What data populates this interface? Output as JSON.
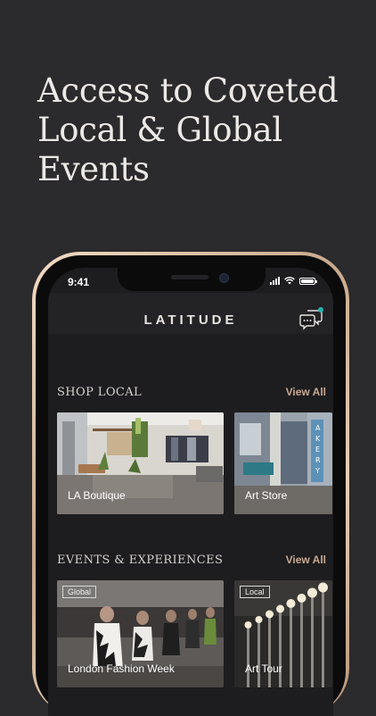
{
  "headline": "Access to Coveted Local & Global Events",
  "status": {
    "time": "9:41"
  },
  "app": {
    "logo": "LATITUDE"
  },
  "icons": {
    "chat": "chat-bubbles-icon",
    "signal": "signal-icon",
    "wifi": "wifi-icon",
    "battery": "battery-icon"
  },
  "colors": {
    "accent": "#c9a992",
    "notification": "#27b3b0",
    "background": "#2b2a2c"
  },
  "shop_local": {
    "title": "SHOP LOCAL",
    "view_all": "View All",
    "cards": [
      {
        "label": "LA Boutique"
      },
      {
        "label": "Art Store"
      }
    ]
  },
  "events": {
    "title": "EVENTS & EXPERIENCES",
    "view_all": "View All",
    "cards": [
      {
        "tag": "Global",
        "label": "London Fashion Week"
      },
      {
        "tag": "Local",
        "label": "Art Tour"
      }
    ]
  }
}
